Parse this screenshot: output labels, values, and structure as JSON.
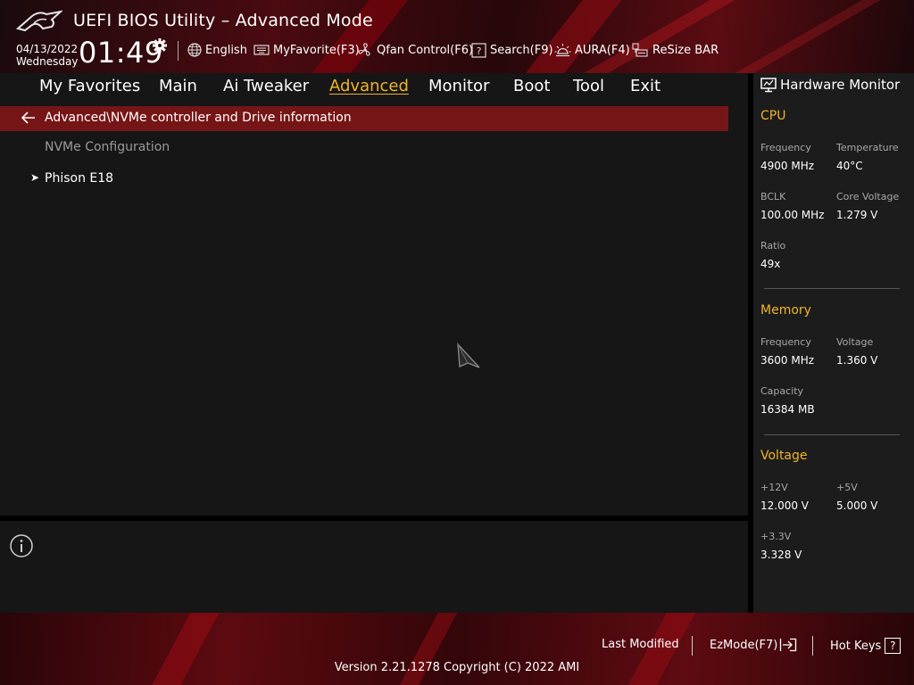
{
  "header": {
    "title": "UEFI BIOS Utility – Advanced Mode",
    "date": "04/13/2022",
    "weekday": "Wednesday",
    "time": "01:49",
    "items": {
      "language": "English",
      "myfavorite": "MyFavorite(F3)",
      "qfan": "Qfan Control(F6)",
      "search": "Search(F9)",
      "aura": "AURA(F4)",
      "resize_bar": "ReSize BAR"
    }
  },
  "tabs": {
    "my_favorites": "My Favorites",
    "main": "Main",
    "ai_tweaker": "Ai Tweaker",
    "advanced": "Advanced",
    "monitor": "Monitor",
    "boot": "Boot",
    "tool": "Tool",
    "exit": "Exit",
    "active": "Advanced"
  },
  "main": {
    "path": "Advanced\\NVMe controller and Drive information",
    "config_label": "NVMe Configuration",
    "drive": "Phison E18"
  },
  "hw_monitor": {
    "title": "Hardware Monitor",
    "cpu": {
      "section": "CPU",
      "frequency_label": "Frequency",
      "frequency": "4900 MHz",
      "temperature_label": "Temperature",
      "temperature": "40°C",
      "bclk_label": "BCLK",
      "bclk": "100.00 MHz",
      "core_voltage_label": "Core Voltage",
      "core_voltage": "1.279 V",
      "ratio_label": "Ratio",
      "ratio": "49x"
    },
    "memory": {
      "section": "Memory",
      "frequency_label": "Frequency",
      "frequency": "3600 MHz",
      "voltage_label": "Voltage",
      "voltage": "1.360 V",
      "capacity_label": "Capacity",
      "capacity": "16384 MB"
    },
    "voltage": {
      "section": "Voltage",
      "v12_label": "+12V",
      "v12": "12.000 V",
      "v5_label": "+5V",
      "v5": "5.000 V",
      "v33_label": "+3.3V",
      "v33": "3.328 V"
    }
  },
  "footer": {
    "last_modified": "Last Modified",
    "ezmode": "EzMode(F7)",
    "hot_keys": "Hot Keys",
    "hot_keys_key": "?",
    "version": "Version 2.21.1278 Copyright (C) 2022 AMI"
  },
  "colors": {
    "accent": "#f0b429",
    "highlight_bar": "#761516",
    "background": "#161616"
  }
}
